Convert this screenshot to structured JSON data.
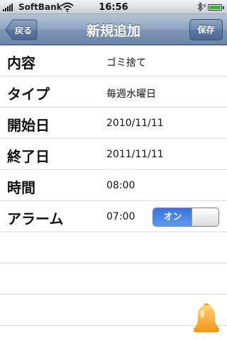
{
  "status_bar": {
    "carrier": "SoftBank",
    "time": "16:56",
    "signal_bars": 5,
    "wifi_icon": "wifi-icon",
    "bluetooth_icon": "bluetooth-icon",
    "battery_icon": "battery-charging-icon"
  },
  "nav": {
    "title": "新規追加",
    "back_label": "戻る",
    "save_label": "保存"
  },
  "rows": [
    {
      "key": "内容",
      "value": "ゴミ捨て"
    },
    {
      "key": "タイプ",
      "value": "毎週水曜日"
    },
    {
      "key": "開始日",
      "value": "2010/11/11"
    },
    {
      "key": "終了日",
      "value": "2011/11/11"
    },
    {
      "key": "時間",
      "value": "08:00"
    },
    {
      "key": "アラーム",
      "value": "07:00",
      "toggle_label": "オン",
      "toggle_state": "on"
    }
  ],
  "colors": {
    "nav_bar": "#7e95b5",
    "toggle_on": "#3b74d9",
    "bell": "#f5a623"
  },
  "bell_icon": "bell-icon"
}
